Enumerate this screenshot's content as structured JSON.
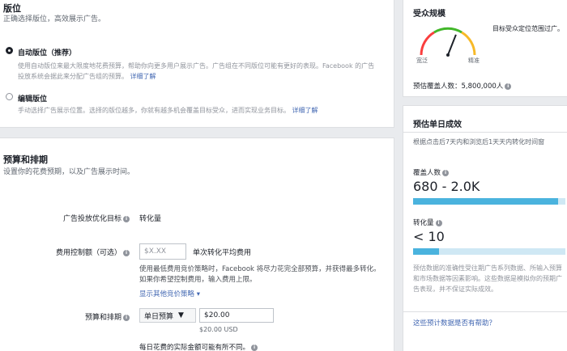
{
  "placement": {
    "title": "版位",
    "subtitle": "正确选择版位，高效展示广告。",
    "auto": {
      "label": "自动版位（推荐）",
      "desc": "使用自动版位来最大限度地花费预算，帮助你向更多用户展示广告。广告组在不同版位可能有更好的表现。Facebook 的广告投放系统会据此来分配广告组的预算。",
      "learn_more": "详细了解"
    },
    "edit": {
      "label": "编辑版位",
      "desc": "手动选择广告展示位置。选择的版位越多，你就有越多机会覆盖目标受众，进而实现业务目标。",
      "learn_more": "详细了解"
    }
  },
  "budget": {
    "title": "预算和排期",
    "subtitle": "设置你的花费预期，以及广告展示时间。",
    "optimization": {
      "label": "广告投放优化目标",
      "value": "转化量"
    },
    "cost_control": {
      "label": "费用控制额（可选）",
      "placeholder": "$X.XX",
      "unit": "单次转化平均费用",
      "desc": "使用最低费用竞价策略时，Facebook 将尽力花完全部预算，并获得最多转化。如果你希望控制费用，输入费用上限。",
      "more_link": "显示其他竞价策略"
    },
    "schedule": {
      "label": "预算和排期",
      "dropdown": "单日预算",
      "amount": "$20.00",
      "amount_hint": "$20.00 USD",
      "note": "每日花费的实际金额可能有所不同。"
    }
  },
  "audience": {
    "title": "受众规模",
    "gauge_label_left": "宽泛",
    "gauge_label_right": "精准",
    "gauge_level": 0.62,
    "side_text": "目标受众定位范围过广。",
    "reach_label": "预估覆盖人数：",
    "reach_value": "5,800,000人"
  },
  "results": {
    "title": "预估单日成效",
    "desc": "根据点击后7天内和浏览后1天天内转化时间窗",
    "reach_label": "覆盖人数",
    "reach_value": "680 - 2.0K",
    "reach_level": 0.95,
    "conv_label": "转化量",
    "conv_value": "< 10",
    "conv_level": 0.17,
    "disclaimer": "预估数据的准确性受往期广告系列数据、所输入预算和市场数据等因素影响。这些数据是模拟你的预期广告表现，并不保证实际成效。",
    "helpful_link": "这些预计数据是否有帮助？"
  },
  "colors": {
    "accent": "#4267b2",
    "bar": "#4ab3de",
    "bar_track": "#cfe8f4",
    "gauge_green": "#42b72a",
    "gauge_yellow": "#f7b928",
    "gauge_red": "#fa3e3e"
  },
  "icons": {
    "info": "info-icon",
    "dropdown": "chevron-down-icon",
    "gauge_needle": "needle-icon"
  }
}
